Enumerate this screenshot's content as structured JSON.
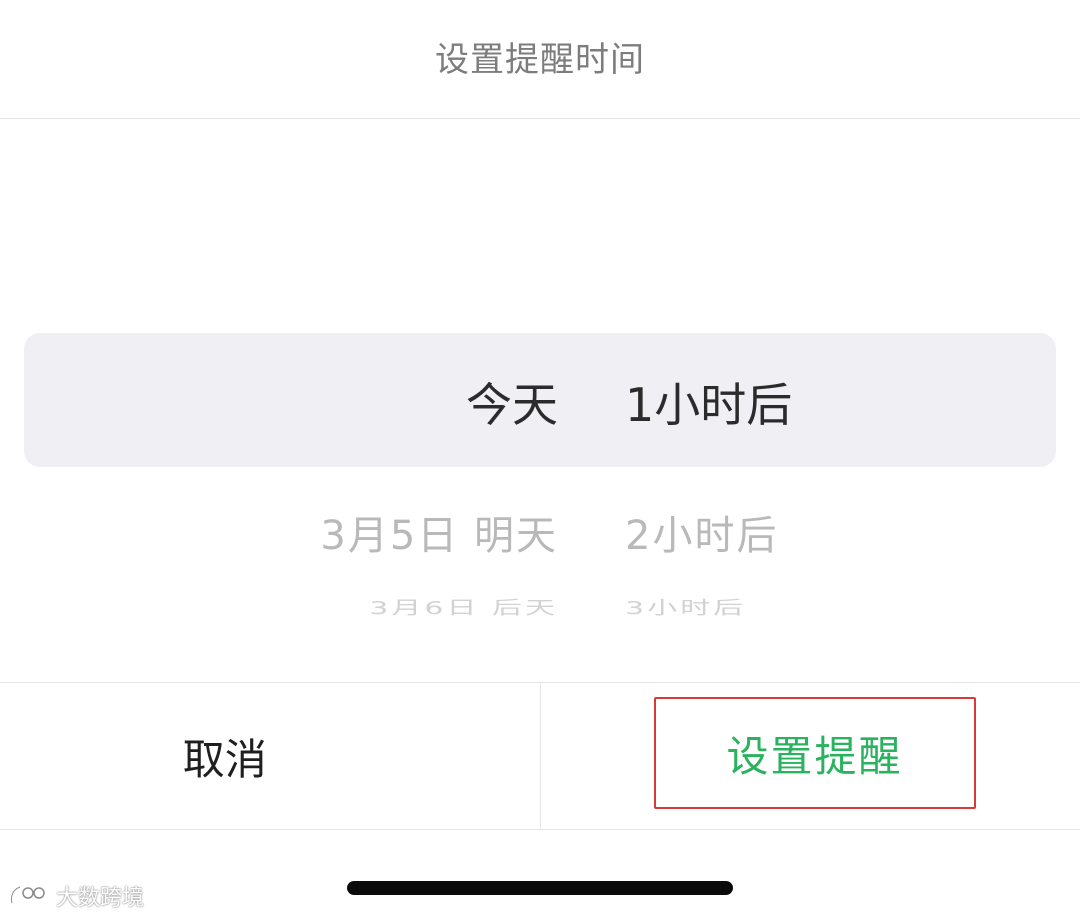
{
  "header": {
    "title": "设置提醒时间"
  },
  "picker": {
    "rows": [
      {
        "date": "今天",
        "offset": "1小时后"
      },
      {
        "date": "3月5日 明天",
        "offset": "2小时后"
      },
      {
        "date": "3月6日 后天",
        "offset": "3小时后"
      }
    ]
  },
  "actions": {
    "cancel_label": "取消",
    "confirm_label": "设置提醒"
  },
  "watermark": {
    "text": "大数跨境",
    "icon": "brand-logo-icon"
  },
  "colors": {
    "confirm_text": "#2bb25e",
    "highlight_outline": "#d83a3a",
    "selection_band": "#efeff4"
  }
}
